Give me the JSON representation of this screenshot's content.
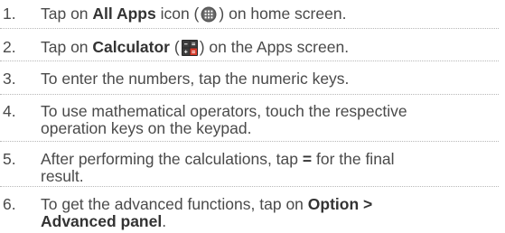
{
  "steps": [
    {
      "num": "1.",
      "pre": "Tap on ",
      "bold": "All Apps",
      "mid": " icon (",
      "icon": "all-apps-icon",
      "post": ") on home screen."
    },
    {
      "num": "2.",
      "pre": "Tap on ",
      "bold": "Calculator",
      "mid": " (",
      "icon": "calculator-icon",
      "post": ") on the Apps screen."
    },
    {
      "num": "3.",
      "text": "To enter the numbers, tap the numeric keys."
    },
    {
      "num": "4.",
      "line1": "To use mathematical operators, touch the respective",
      "line2": "operation keys on the keypad."
    },
    {
      "num": "5.",
      "line1_pre": "After performing the calculations, tap ",
      "line1_bold": "=",
      "line1_post": " for the final",
      "line2": "result."
    },
    {
      "num": "6.",
      "line1_pre": "To get the advanced functions, tap on ",
      "line1_bold": "Option >",
      "line2_bold": "Advanced panel",
      "line2_post": "."
    }
  ],
  "colors": {
    "text": "#4a4a4a",
    "bold_text": "#333333",
    "divider": "#b8b8b8",
    "calculator_icon_top": "#2a2a2a",
    "calculator_icon_accent": "#d63a2a"
  }
}
